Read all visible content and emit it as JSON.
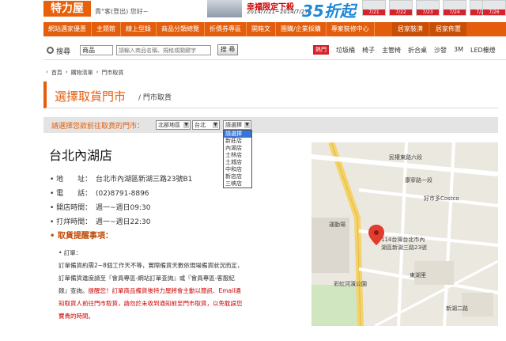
{
  "header": {
    "logo": "特力屋",
    "greeting": "貴°客(登出) 您好~",
    "promo_title": "幸福限定下殺",
    "promo_date": "2014/7/21~2014/7/27",
    "promo_big": "35折起",
    "thumbs": [
      "7/21",
      "7/22",
      "7/23",
      "7/24",
      "7/25",
      "7/26"
    ]
  },
  "nav": {
    "items": [
      "網站邁家優惠",
      "主題館",
      "線上型錄",
      "商品分類總覽",
      "折價券專區",
      "開箱文",
      "團購/企業採購",
      "專案裝修中心"
    ],
    "right": [
      "居家裝潢",
      "居家佈置"
    ]
  },
  "search": {
    "label": "搜尋",
    "category": "商品",
    "placeholder": "請輸入商品名稱、規格或關鍵字",
    "button": "搜 尋",
    "hot_label": "熱門",
    "hot_links": [
      "垃圾桶",
      "椅子",
      "主管椅",
      "折合桌",
      "沙發",
      "3M",
      "LED檯燈"
    ]
  },
  "breadcrumb": [
    "首頁",
    "購物清單",
    "門市取貨"
  ],
  "title": {
    "main": "選擇取貨門市",
    "sub": "/ 門市取貨"
  },
  "chooser": {
    "label": "請選擇您欲前往取貨的門市：",
    "region": "北部地區",
    "city": "台北",
    "store": "請選擇",
    "options": [
      "請選擇",
      "新莊店",
      "內湖店",
      "士林店",
      "土城店",
      "中和店",
      "新店店",
      "三峽店"
    ]
  },
  "store": {
    "name": "台北內湖店",
    "rows": [
      {
        "label": "• 地　　址：",
        "value": "台北市內湖區新湖三路23號B1"
      },
      {
        "label": "• 電　　話：",
        "value": "(02)8791-8896"
      },
      {
        "label": "• 開店時間：",
        "value": "週一~週日09:30"
      },
      {
        "label": "• 打烊時間：",
        "value": "週一~週日22:30"
      }
    ],
    "reminder": "• 取貨提醒事項：",
    "notes": {
      "heading": "• 訂單：",
      "line1": "訂單備貨約需2~8個工作天不等，實際備貨天數依現場備貨狀況而定，",
      "line2": "訂單備貨進度請至『會員專區-網站訂單查詢』或『會員專區-客服紀",
      "line3_a": "錄』查詢。",
      "line3_b": "提醒您！訂單商品備貨後特力屋將會主動以簡訊、Email通",
      "line4": "知取貨人前往門市取貨，請勿於未收到通知前至門市取貨，以免耽誤您",
      "line5": "寶貴的時間。"
    }
  },
  "map": {
    "labels": [
      "民權東路六段",
      "康寧路一段",
      "好市多Costco",
      "運動場",
      "114台灣台北市內",
      "湖區新湖三路23號",
      "東湖里",
      "彩虹河濱公園",
      "新湖二路"
    ]
  },
  "colors": {
    "brand_orange": "#e35d0c",
    "nav_dark": "#c94e06",
    "promo_blue": "#1e88d8",
    "hot_red": "#d6232a"
  }
}
